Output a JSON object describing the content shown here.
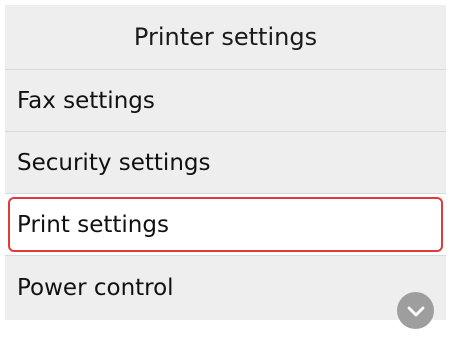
{
  "header": {
    "title": "Printer settings"
  },
  "menu": {
    "items": [
      {
        "label": "Fax settings",
        "selected": false
      },
      {
        "label": "Security settings",
        "selected": false
      },
      {
        "label": "Print settings",
        "selected": true
      },
      {
        "label": "Power control",
        "selected": false
      }
    ]
  },
  "controls": {
    "scroll_down_icon": "chevron-down-icon"
  },
  "colors": {
    "selection_border": "#e23a3a",
    "row_background": "#eeeeee",
    "scroll_button": "#9e9e9e"
  }
}
